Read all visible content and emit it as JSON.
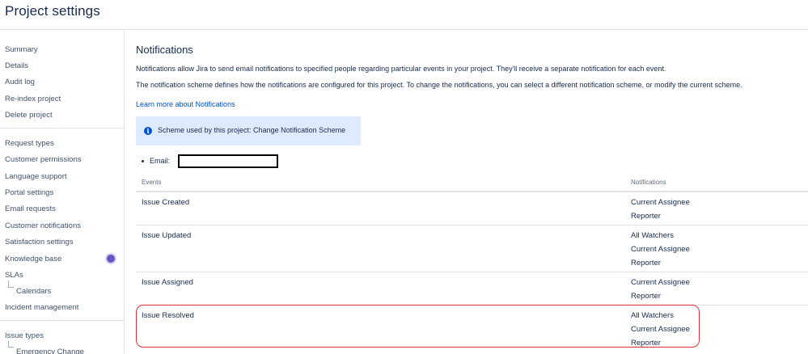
{
  "header": {
    "title": "Project settings"
  },
  "sidebar": {
    "items": [
      "Summary",
      "Details",
      "Audit log",
      "Re-index project",
      "Delete project",
      "Request types",
      "Customer permissions",
      "Language support",
      "Portal settings",
      "Email requests",
      "Customer notifications",
      "Satisfaction settings",
      "Knowledge base",
      "SLAs",
      "Calendars",
      "Incident management",
      "Issue types",
      "Emergency Change"
    ]
  },
  "main": {
    "title": "Notifications",
    "desc1": "Notifications allow Jira to send email notifications to specified people regarding particular events in your project. They'll receive a separate notification for each event.",
    "desc2": "The notification scheme defines how the notifications are configured for this project. To change the notifications, you can select a different notification scheme, or modify the current scheme.",
    "learn_link": "Learn more about Notifications",
    "info": {
      "icon": "info-icon",
      "text": "Scheme used by this project: Change Notification Scheme"
    },
    "email_label": "Email:",
    "table": {
      "headers": {
        "events": "Events",
        "notifications": "Notifications"
      },
      "rows": [
        {
          "event": "Issue Created",
          "notifications": [
            "Current Assignee",
            "Reporter"
          ]
        },
        {
          "event": "Issue Updated",
          "notifications": [
            "All Watchers",
            "Current Assignee",
            "Reporter"
          ]
        },
        {
          "event": "Issue Assigned",
          "notifications": [
            "Current Assignee",
            "Reporter"
          ]
        },
        {
          "event": "Issue Resolved",
          "notifications": [
            "All Watchers",
            "Current Assignee",
            "Reporter"
          ]
        }
      ]
    }
  },
  "colors": {
    "link": "#0052cc",
    "info_bg": "#deebff",
    "highlight": "#e0303a",
    "kb_badge": "#6554c0"
  }
}
